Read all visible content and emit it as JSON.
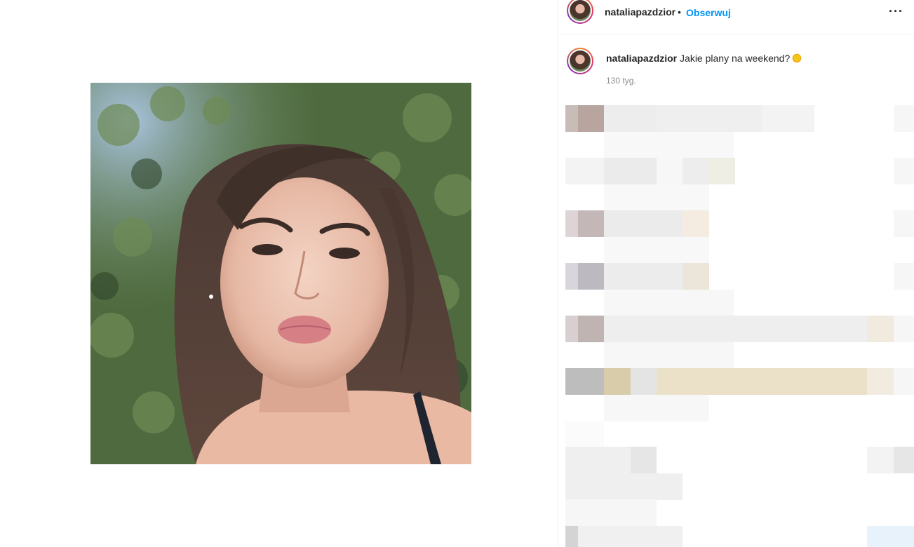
{
  "post": {
    "username": "nataliapazdzior",
    "separator": "•",
    "follow_label": "Obserwuj",
    "more_label": "···",
    "caption_user": "nataliapazdzior",
    "caption_text": "Jakie plany na weekend?",
    "caption_emoji": "sun-emoji",
    "timestamp": "130 tyg."
  },
  "colors": {
    "follow": "#0095f6",
    "text": "#262626",
    "muted": "#8e8e8e",
    "border": "#efefef"
  },
  "icons": {
    "more": "more-options-icon",
    "avatar": "profile-avatar"
  }
}
